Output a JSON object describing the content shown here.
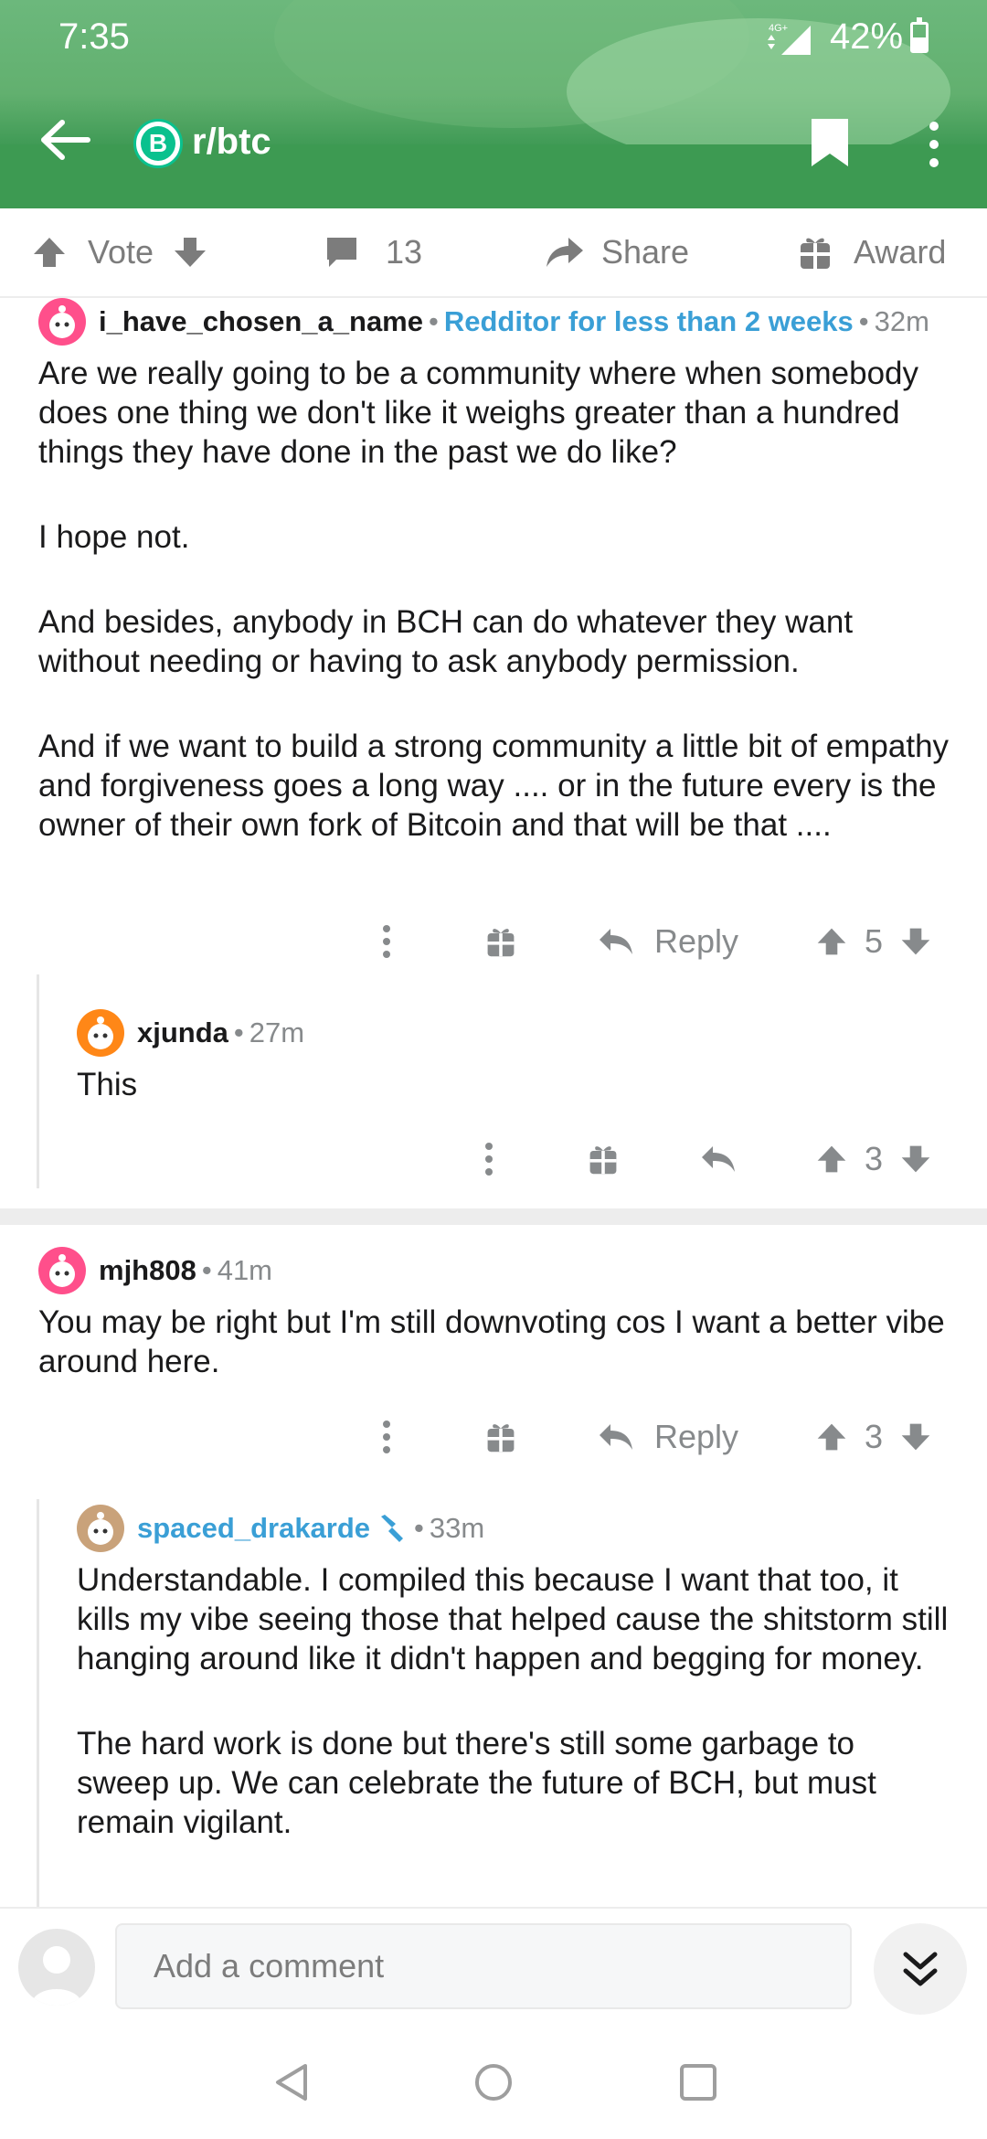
{
  "status_bar": {
    "time": "7:35",
    "network": "4G+",
    "battery": "42%"
  },
  "header": {
    "subreddit": "r/btc",
    "subreddit_icon_glyph": "B"
  },
  "actions": {
    "vote_label": "Vote",
    "comment_count": "13",
    "share_label": "Share",
    "award_label": "Award"
  },
  "comments": [
    {
      "username": "i_have_chosen_a_name",
      "flair": "Redditor for less than 2 weeks",
      "age": "32m",
      "paragraphs": [
        "Are we really going to be a community where when somebody does one thing we don't like it weighs greater than a hundred things they have done in the past we do like?",
        "I hope not.",
        "And besides, anybody in BCH can do whatever they want without needing or having to ask anybody permission.",
        "And if we want to build a strong community a little bit of empathy and forgiveness goes a long way .... or in the future every is the owner of their own fork of Bitcoin and that will be that ...."
      ],
      "reply_label": "Reply",
      "score": "5",
      "avatar_color": "#ff4f8b"
    },
    {
      "username": "xjunda",
      "age": "27m",
      "paragraphs": [
        "This"
      ],
      "score": "3",
      "avatar_color": "#ff8717"
    },
    {
      "username": "mjh808",
      "age": "41m",
      "paragraphs": [
        "You may be right but I'm still downvoting cos I want a better vibe around here."
      ],
      "reply_label": "Reply",
      "score": "3",
      "avatar_color": "#ff4f8b"
    },
    {
      "username": "spaced_drakarde",
      "age": "33m",
      "paragraphs": [
        "Understandable. I compiled this because I want that too, it kills my vibe seeing those that helped cause the shitstorm still hanging around like it didn't happen and begging for money.",
        "The hard work is done but there's still some garbage to sweep up. We can celebrate the future of BCH, but must remain vigilant."
      ],
      "avatar_color": "#c9a27a",
      "username_color": "#3a9fd6"
    }
  ],
  "composer": {
    "placeholder": "Add a comment"
  },
  "colors": {
    "header_green": "#3d9a52",
    "flair_blue": "#3a9fd6",
    "bch_green": "#0ac18e",
    "muted": "#878a8c"
  }
}
